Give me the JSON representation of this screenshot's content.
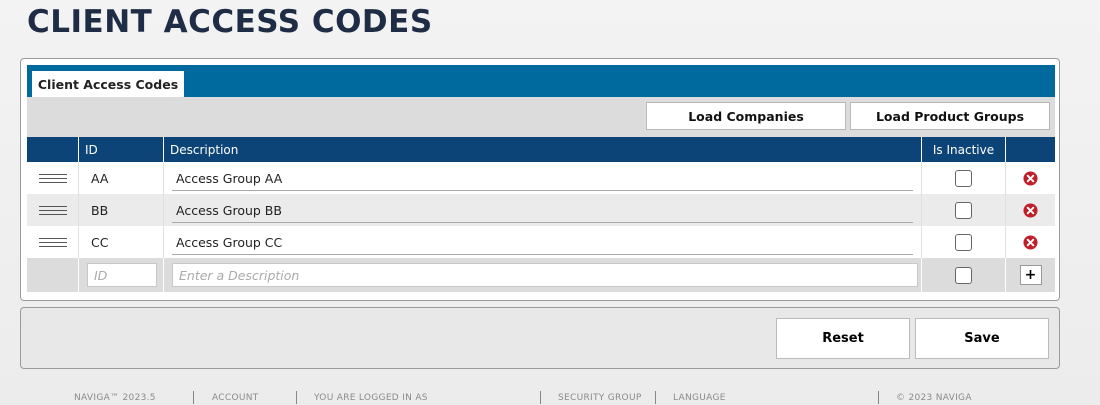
{
  "page": {
    "title": "CLIENT ACCESS CODES"
  },
  "tabs": [
    {
      "label": "Client Access Codes",
      "active": true
    }
  ],
  "toolbar": {
    "load_companies_label": "Load Companies",
    "load_product_groups_label": "Load Product Groups"
  },
  "grid": {
    "columns": {
      "id": "ID",
      "description": "Description",
      "is_inactive": "Is Inactive"
    },
    "rows": [
      {
        "id": "AA",
        "description": "Access Group AA",
        "inactive": false
      },
      {
        "id": "BB",
        "description": "Access Group BB",
        "inactive": false
      },
      {
        "id": "CC",
        "description": "Access Group CC",
        "inactive": false
      }
    ],
    "new_row": {
      "id_placeholder": "ID",
      "description_placeholder": "Enter a Description",
      "add_label": "+"
    }
  },
  "actions": {
    "reset_label": "Reset",
    "save_label": "Save"
  },
  "footer": {
    "version": "NAVIGA™ 2023.5",
    "account": "ACCOUNT",
    "logged_in": "YOU ARE LOGGED IN AS",
    "security_group": "SECURITY GROUP",
    "language": "LANGUAGE",
    "copyright": "© 2023 NAVIGA"
  },
  "colors": {
    "tab_strip": "#006a9e",
    "grid_header": "#0d4478",
    "title": "#1e2d45",
    "delete_icon": "#c0202a"
  },
  "icons": {
    "row_handle": "drag-handle-icon",
    "row_delete": "delete-circle-x-icon"
  }
}
